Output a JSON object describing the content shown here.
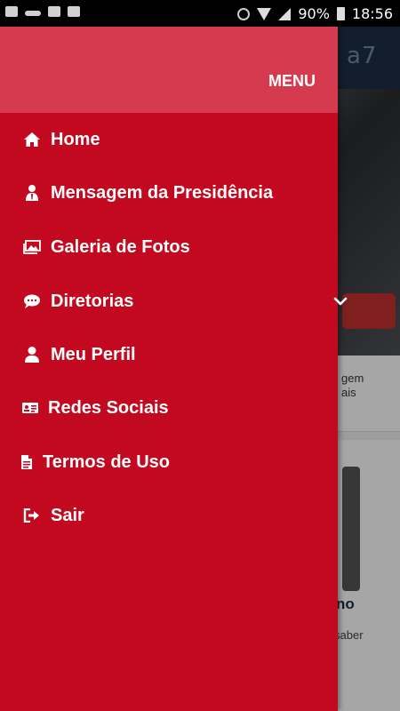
{
  "status_bar": {
    "battery": "90%",
    "time": "18:56"
  },
  "background": {
    "logo_text": "a7",
    "card1_text": "gem\nais",
    "card2_title": "no",
    "card2_text": "saber"
  },
  "drawer": {
    "title": "MENU",
    "items": [
      {
        "label": "Home",
        "icon": "home-icon"
      },
      {
        "label": "Mensagem da Presidência",
        "icon": "presidency-icon"
      },
      {
        "label": "Galeria de Fotos",
        "icon": "photo-gallery-icon"
      },
      {
        "label": "Diretorias",
        "icon": "chat-bubble-icon"
      },
      {
        "label": "Meu Perfil",
        "icon": "user-icon"
      },
      {
        "label": "Redes Sociais",
        "icon": "id-card-icon"
      },
      {
        "label": "Termos de Uso",
        "icon": "document-icon"
      },
      {
        "label": "Sair",
        "icon": "sign-out-icon"
      }
    ]
  },
  "colors": {
    "drawer_bg": "#c2091f",
    "drawer_header_bg": "#d63a4e",
    "text": "#ffffff"
  }
}
